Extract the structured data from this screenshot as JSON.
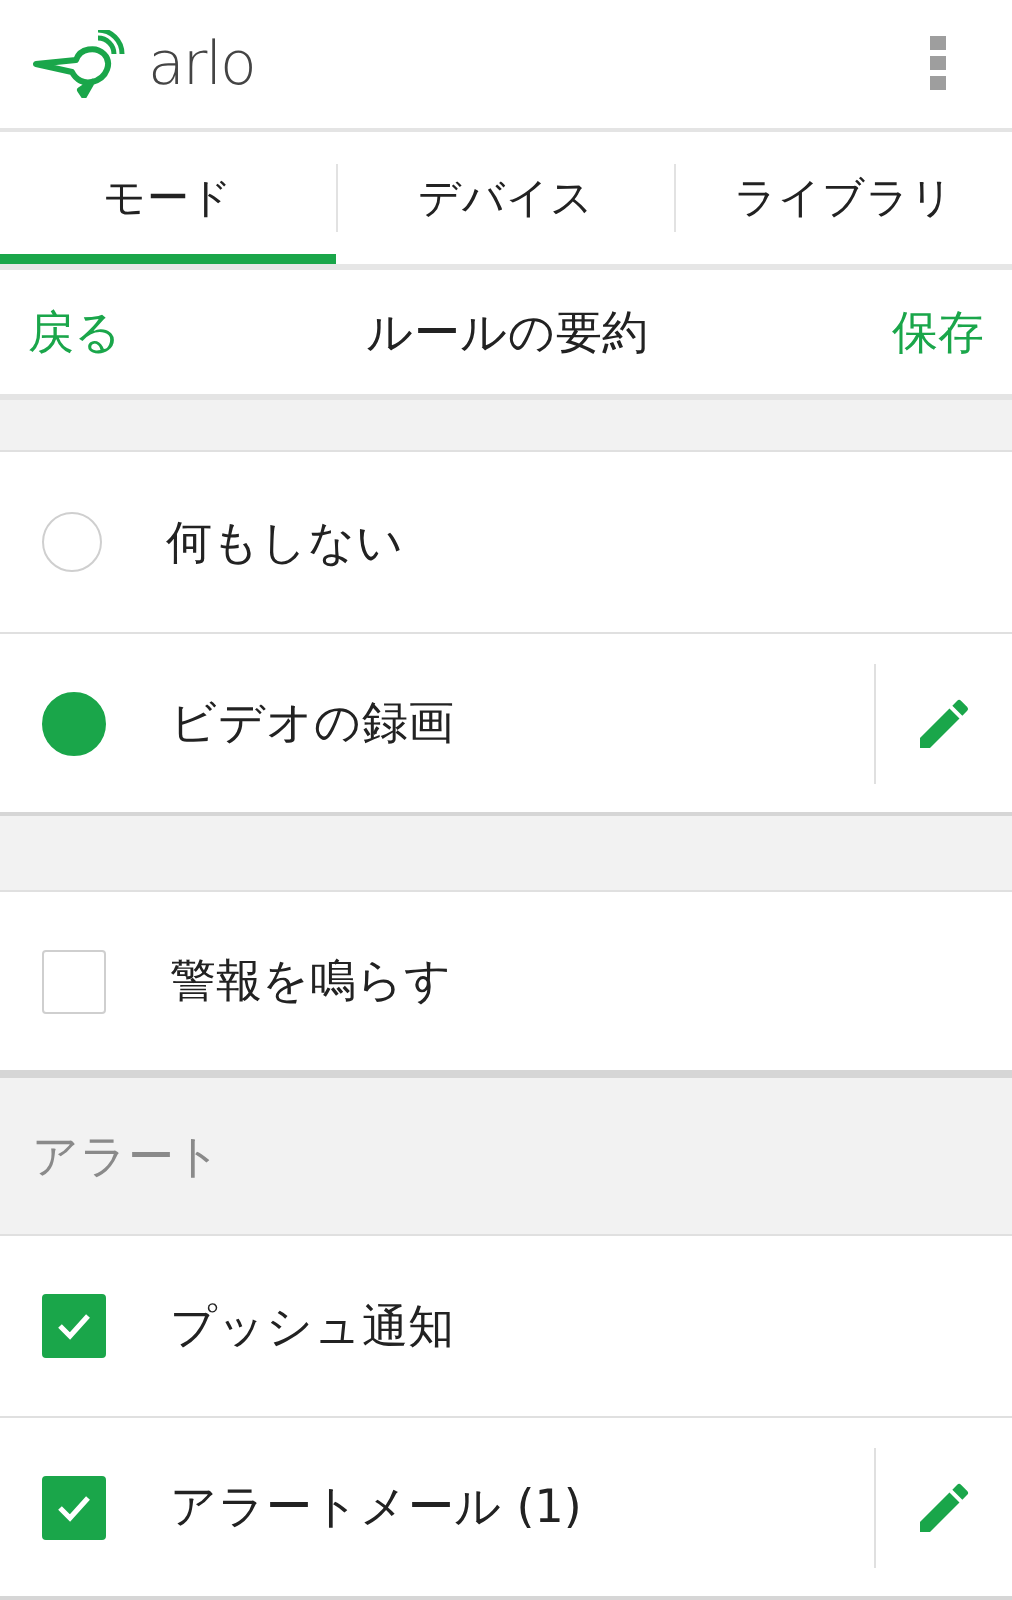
{
  "app": {
    "logo": "arlo"
  },
  "tabs": [
    {
      "label": "モード",
      "selected": true
    },
    {
      "label": "デバイス",
      "selected": false
    },
    {
      "label": "ライブラリ",
      "selected": false
    }
  ],
  "nav": {
    "back": "戻る",
    "title": "ルールの要約",
    "save": "保存"
  },
  "groups": [
    {
      "items": [
        {
          "kind": "radio",
          "label": "何もしない",
          "selected": false,
          "editable": false
        },
        {
          "kind": "radio",
          "label": "ビデオの録画",
          "selected": true,
          "editable": true
        }
      ]
    },
    {
      "items": [
        {
          "kind": "checkbox",
          "label": "警報を鳴らす",
          "checked": false,
          "editable": false
        }
      ]
    },
    {
      "header": "アラート",
      "items": [
        {
          "kind": "checkbox",
          "label": "プッシュ通知",
          "checked": true,
          "editable": false
        },
        {
          "kind": "checkbox",
          "label": "アラートメール (1)",
          "checked": true,
          "editable": true
        }
      ]
    }
  ]
}
